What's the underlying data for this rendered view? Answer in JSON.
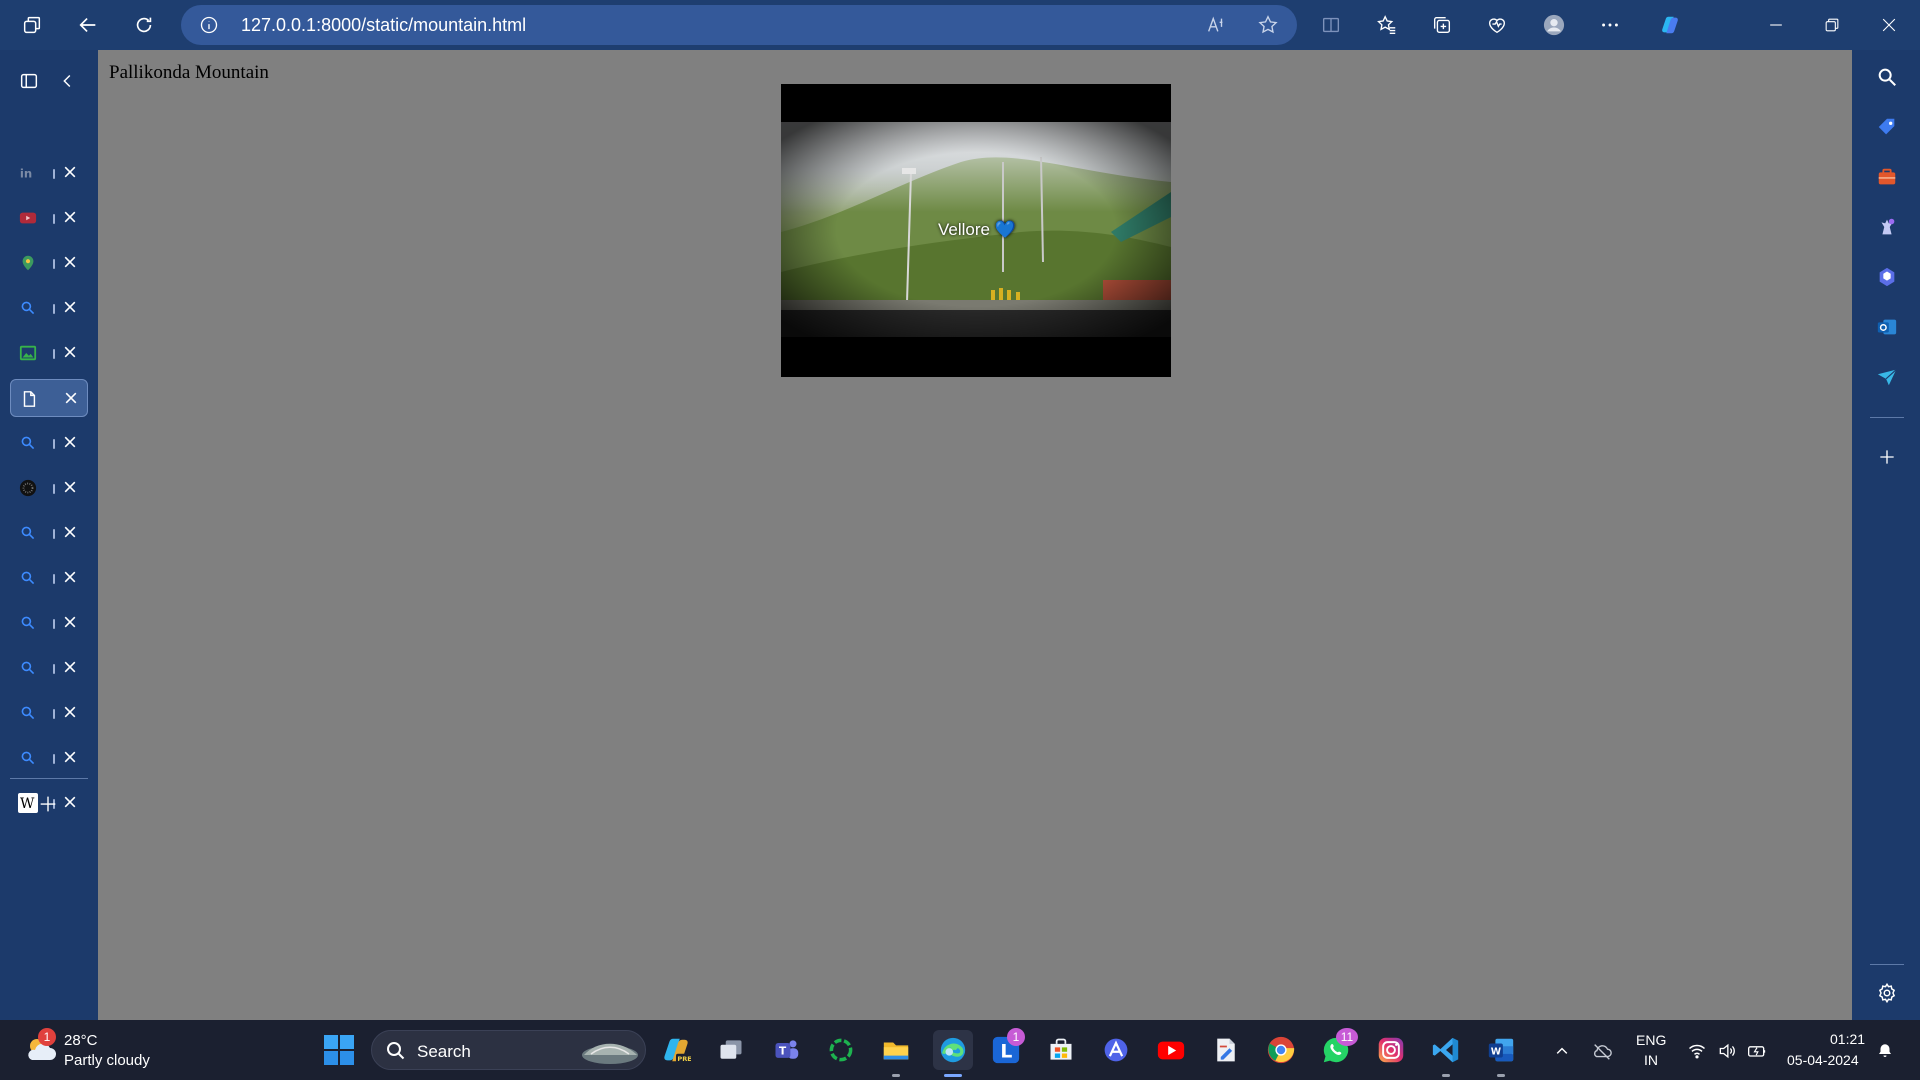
{
  "browser": {
    "url": "127.0.0.1:8000/static/mountain.html",
    "accent": "#1e3e70",
    "address_bg": "#34599a"
  },
  "vertical_tabs": [
    {
      "icon": "linkedin-icon",
      "active": false
    },
    {
      "icon": "youtube-icon",
      "active": false
    },
    {
      "icon": "maps-pin-icon",
      "active": false
    },
    {
      "icon": "search-icon",
      "active": false
    },
    {
      "icon": "image-icon",
      "active": false
    },
    {
      "icon": "document-icon",
      "active": true
    },
    {
      "icon": "search-icon",
      "active": false
    },
    {
      "icon": "dotted-circle-icon",
      "active": false
    },
    {
      "icon": "search-icon",
      "active": false
    },
    {
      "icon": "search-icon",
      "active": false
    },
    {
      "icon": "search-icon",
      "active": false
    },
    {
      "icon": "search-icon",
      "active": false
    },
    {
      "icon": "search-icon",
      "active": false
    },
    {
      "icon": "search-icon",
      "active": false
    },
    {
      "icon": "wikipedia-icon",
      "active": false
    }
  ],
  "page": {
    "heading": "Pallikonda Mountain",
    "background": "#808080",
    "video": {
      "caption": "Vellore 💙"
    }
  },
  "taskbar": {
    "weather": {
      "temp": "28°C",
      "desc": "Partly cloudy",
      "badge": "1"
    },
    "search_label": "Search",
    "badges": {
      "letter_app": "1",
      "whatsapp": "11"
    },
    "lang_top": "ENG",
    "lang_bottom": "IN",
    "time": "01:21",
    "date": "05-04-2024"
  }
}
